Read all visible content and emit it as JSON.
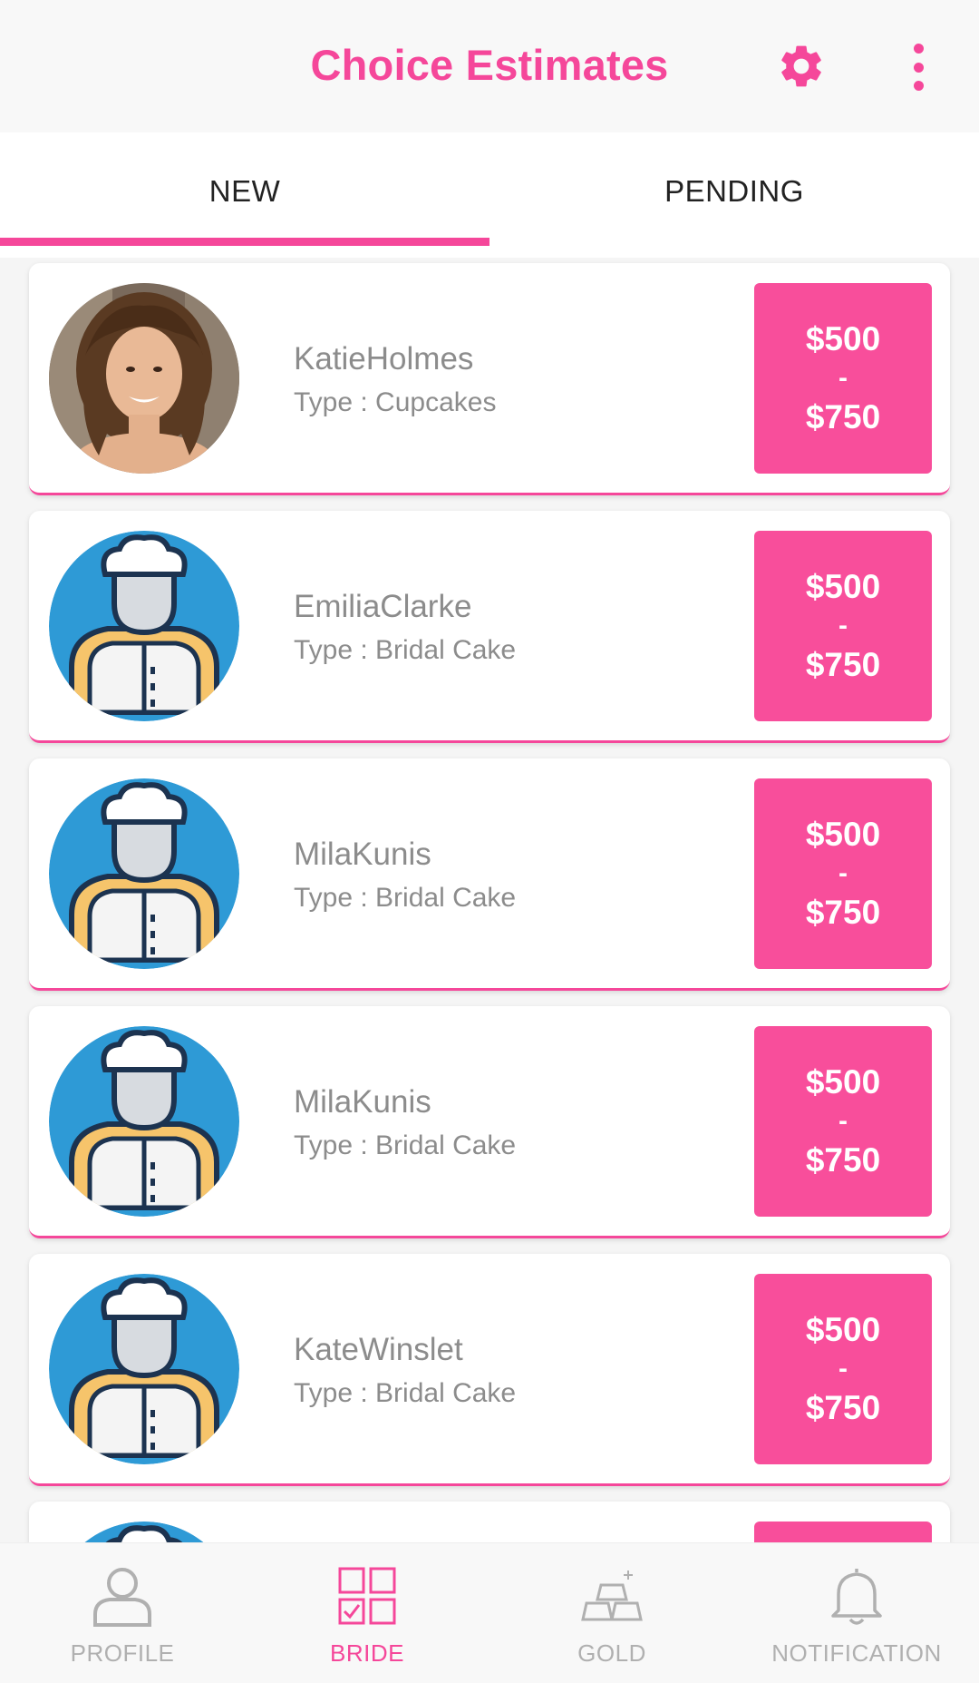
{
  "header": {
    "title": "Choice Estimates",
    "settings_icon": "gear-icon",
    "menu_icon": "more-vertical-icon",
    "accent_color": "#f5479a"
  },
  "tabs": [
    {
      "label": "NEW",
      "selected": true
    },
    {
      "label": "PENDING",
      "selected": false
    }
  ],
  "estimates": [
    {
      "name": "KatieHolmes",
      "type": "Type : Cupcakes",
      "price_low": "$500",
      "price_sep": "-",
      "price_high": "$750",
      "avatar": "photo"
    },
    {
      "name": "EmiliaClarke",
      "type": "Type : Bridal Cake",
      "price_low": "$500",
      "price_sep": "-",
      "price_high": "$750",
      "avatar": "chef-icon"
    },
    {
      "name": "MilaKunis",
      "type": "Type : Bridal Cake",
      "price_low": "$500",
      "price_sep": "-",
      "price_high": "$750",
      "avatar": "chef-icon"
    },
    {
      "name": "MilaKunis",
      "type": "Type : Bridal Cake",
      "price_low": "$500",
      "price_sep": "-",
      "price_high": "$750",
      "avatar": "chef-icon"
    },
    {
      "name": "KateWinslet",
      "type": "Type : Bridal Cake",
      "price_low": "$500",
      "price_sep": "-",
      "price_high": "$750",
      "avatar": "chef-icon"
    }
  ],
  "bottom_nav": [
    {
      "label": "PROFILE",
      "icon": "person-icon",
      "active": false
    },
    {
      "label": "BRIDE",
      "icon": "grid-check-icon",
      "active": true
    },
    {
      "label": "GOLD",
      "icon": "gold-bars-icon",
      "active": false
    },
    {
      "label": "NOTIFICATION",
      "icon": "bell-icon",
      "active": false
    }
  ]
}
